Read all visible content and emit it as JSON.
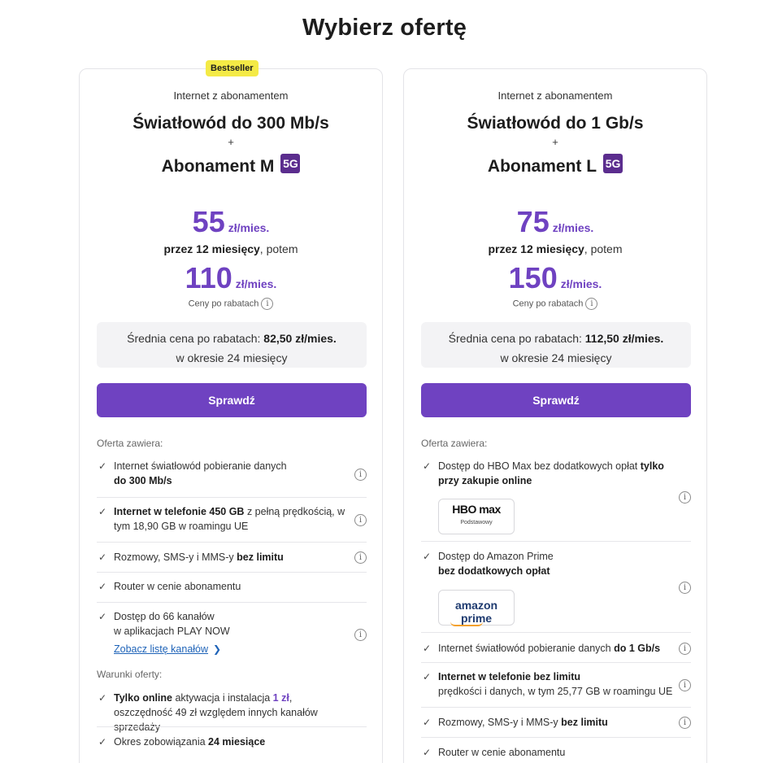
{
  "page": {
    "title": "Wybierz ofertę"
  },
  "colors": {
    "accent": "#6f42c1",
    "badge": "#f4ea46",
    "badge_5g": "#5b2d8e"
  },
  "cards": [
    {
      "badge": "Bestseller",
      "subtitle": "Internet z abonamentem",
      "plan_line1": "Światłowód do 300 Mb/s",
      "plus": "+",
      "plan_line2": "Abonament M",
      "badge_5g": "5G",
      "price_promo": "55",
      "price_unit": "zł/mies.",
      "period_bold": "przez 12 miesięcy",
      "period_rest": ", potem",
      "price_regular": "110",
      "discount_note": "Ceny po rabatach",
      "avg_label": "Średnia cena po rabatach: ",
      "avg_value": "82,50 zł/mies.",
      "avg_period": "w okresie 24 miesięcy",
      "cta": "Sprawdź",
      "offer_label": "Oferta zawiera:",
      "features": [
        {
          "pre": "Internet światłowód pobieranie danych",
          "bold": "do 300 Mb/s",
          "post": ""
        },
        {
          "pre": "",
          "bold": "Internet w telefonie 450 GB",
          "post": " z pełną prędkością, w tym 18,90 GB w roamingu UE"
        },
        {
          "pre": "Rozmowy, SMS-y i MMS-y ",
          "bold": "bez limitu",
          "post": ""
        },
        {
          "pre": "Router w cenie abonamentu",
          "bold": "",
          "post": ""
        },
        {
          "pre": "Dostęp do 66 kanałów",
          "line2": "w aplikacjach PLAY NOW",
          "link": "Zobacz listę kanałów"
        }
      ],
      "terms_label": "Warunki oferty:",
      "terms": [
        {
          "bold": "Tylko online",
          "pre": " aktywacja i instalacja ",
          "red": "1 zł",
          "post": ", oszczędność 49 zł względem innych kanałów sprzedaży"
        },
        {
          "pre": "Okres zobowiązania ",
          "bold": "24 miesiące"
        }
      ]
    },
    {
      "subtitle": "Internet z abonamentem",
      "plan_line1": "Światłowód do 1 Gb/s",
      "plus": "+",
      "plan_line2": "Abonament L",
      "badge_5g": "5G",
      "price_promo": "75",
      "price_unit": "zł/mies.",
      "period_bold": "przez 12 miesięcy",
      "period_rest": ", potem",
      "price_regular": "150",
      "discount_note": "Ceny po rabatach",
      "avg_label": "Średnia cena po rabatach: ",
      "avg_value": "112,50 zł/mies.",
      "avg_period": "w okresie 24 miesięcy",
      "cta": "Sprawdź",
      "offer_label": "Oferta zawiera:",
      "features": [
        {
          "pre": "Dostęp do HBO Max bez dodatkowych opłat ",
          "bold": "tylko przy zakupie online",
          "logo_main": "HBO max",
          "logo_sub": "Podstawowy"
        },
        {
          "pre": "Dostęp do Amazon Prime",
          "bold": "bez dodatkowych opłat",
          "logo_main": "amazon prime"
        },
        {
          "pre": "Internet światłowód pobieranie danych ",
          "bold": "do 1 Gb/s",
          "post": ""
        },
        {
          "pre": "",
          "bold": "Internet w telefonie bez limitu",
          "post": "prędkości i danych, w tym 25,77 GB w roamingu UE"
        },
        {
          "pre": "Rozmowy, SMS-y i MMS-y ",
          "bold": "bez limitu",
          "post": ""
        },
        {
          "pre": "Router w cenie abonamentu",
          "bold": "",
          "post": ""
        }
      ]
    }
  ]
}
